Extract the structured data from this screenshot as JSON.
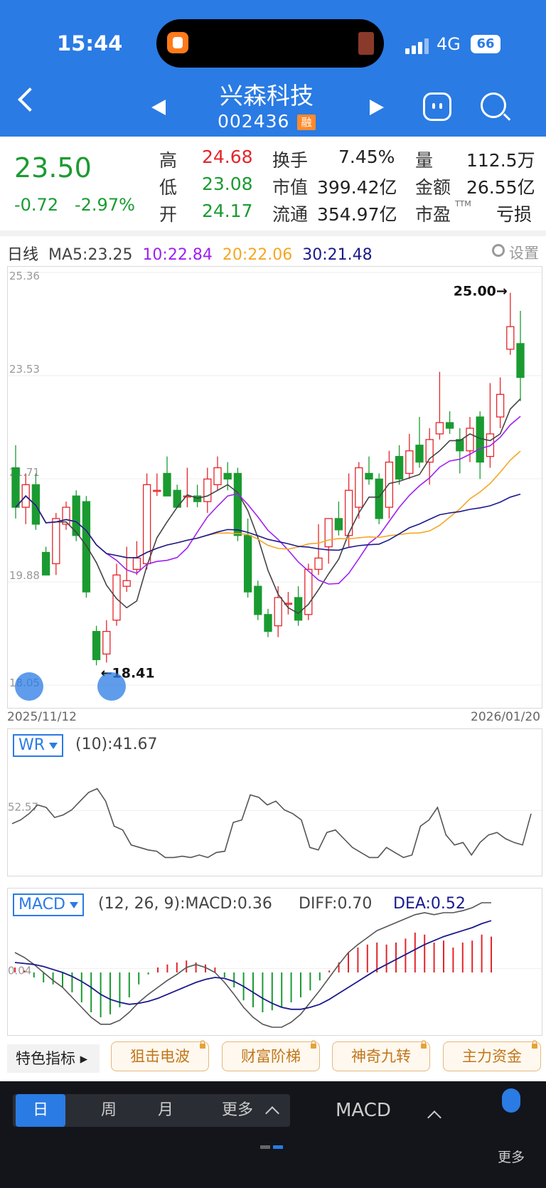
{
  "status_bar": {
    "time": "15:44",
    "network": "4G",
    "battery": "66"
  },
  "header": {
    "name": "兴森科技",
    "code": "002436",
    "margin_badge": "融"
  },
  "quote": {
    "price": "23.50",
    "change": "-0.72",
    "change_pct": "-2.97%",
    "high_label": "高",
    "high": "24.68",
    "low_label": "低",
    "low": "23.08",
    "open_label": "开",
    "open": "24.17",
    "turnover_label": "换手",
    "turnover": "7.45%",
    "mcap_label": "市值",
    "mcap": "399.42亿",
    "float_label": "流通",
    "float": "354.97亿",
    "vol_label": "量",
    "vol": "112.5万",
    "amount_label": "金额",
    "amount": "26.55亿",
    "pe_label": "市盈",
    "pe_sup": "TTM",
    "pe": "亏损"
  },
  "ma_legend": {
    "period": "日线",
    "ma5": "MA5:23.25",
    "ma10": "10:22.84",
    "ma20": "20:22.06",
    "ma30": "30:21.48",
    "settings": "设置"
  },
  "colors": {
    "up": "#e4252b",
    "down": "#1a9b31",
    "ma5": "#444444",
    "ma10": "#a020f0",
    "ma20": "#f5a623",
    "ma30": "#1a1a8c",
    "accent": "#2a7be4"
  },
  "main_chart": {
    "ylabels": [
      "25.36",
      "23.53",
      "21.71",
      "19.88",
      "18.05"
    ],
    "start_date": "2025/11/12",
    "end_date": "2026/01/20",
    "high_marker": "25.00→",
    "low_marker": "←18.41"
  },
  "wr": {
    "name": "WR",
    "value": "(10):41.67",
    "level": "52.57"
  },
  "macd": {
    "name": "MACD",
    "params": "(12, 26, 9):MACD:0.36",
    "diff": "DIFF:0.70",
    "dea": "DEA:0.52",
    "level": "0.04"
  },
  "features": {
    "title": "特色指标",
    "items": [
      "狙击电波",
      "财富阶梯",
      "神奇九转",
      "主力资金"
    ]
  },
  "bottom": {
    "tabs": [
      "日",
      "周",
      "月",
      "更多"
    ],
    "indicator": "MACD",
    "more": "更多"
  },
  "chart_data": [
    {
      "type": "candlestick",
      "title": "",
      "ylim": [
        18.05,
        25.36
      ],
      "x_range": [
        "2025/11/12",
        "2026/01/20"
      ],
      "candles_ohlc": [
        [
          21.9,
          22.3,
          21.0,
          21.2
        ],
        [
          21.2,
          21.8,
          20.9,
          21.6
        ],
        [
          21.6,
          21.8,
          20.8,
          20.9
        ],
        [
          20.4,
          20.5,
          20.0,
          20.0
        ],
        [
          20.2,
          21.1,
          20.0,
          21.0
        ],
        [
          20.9,
          21.3,
          20.8,
          21.2
        ],
        [
          21.4,
          21.5,
          20.6,
          20.7
        ],
        [
          21.3,
          21.4,
          19.6,
          19.7
        ],
        [
          19.0,
          19.1,
          18.4,
          18.5
        ],
        [
          18.6,
          19.2,
          18.45,
          19.0
        ],
        [
          19.2,
          20.2,
          19.1,
          20.0
        ],
        [
          19.8,
          20.5,
          19.7,
          19.9
        ],
        [
          20.1,
          20.6,
          20.0,
          20.3
        ],
        [
          20.2,
          21.8,
          20.1,
          21.6
        ],
        [
          21.5,
          21.8,
          21.4,
          21.5
        ],
        [
          21.8,
          22.1,
          21.4,
          21.4
        ],
        [
          21.5,
          21.6,
          21.2,
          21.2
        ],
        [
          21.4,
          21.9,
          21.2,
          21.4
        ],
        [
          21.4,
          21.6,
          21.2,
          21.3
        ],
        [
          21.3,
          21.9,
          21.1,
          21.7
        ],
        [
          21.6,
          22.1,
          21.5,
          21.9
        ],
        [
          21.8,
          22.0,
          21.5,
          21.7
        ],
        [
          21.8,
          21.9,
          20.6,
          20.7
        ],
        [
          20.7,
          21.0,
          19.6,
          19.7
        ],
        [
          19.8,
          19.9,
          19.2,
          19.3
        ],
        [
          19.3,
          19.4,
          18.9,
          19.0
        ],
        [
          19.1,
          19.8,
          18.9,
          19.6
        ],
        [
          19.5,
          19.7,
          19.3,
          19.5
        ],
        [
          19.6,
          19.8,
          19.1,
          19.2
        ],
        [
          19.3,
          20.2,
          19.2,
          20.1
        ],
        [
          20.1,
          20.9,
          20.0,
          20.3
        ],
        [
          20.5,
          21.0,
          20.2,
          21.0
        ],
        [
          21.0,
          21.3,
          20.7,
          20.8
        ],
        [
          20.7,
          21.8,
          20.5,
          21.5
        ],
        [
          21.2,
          22.0,
          21.0,
          21.9
        ],
        [
          21.8,
          22.1,
          21.6,
          21.7
        ],
        [
          21.7,
          21.8,
          20.9,
          21.0
        ],
        [
          21.2,
          22.2,
          21.0,
          22.0
        ],
        [
          22.1,
          22.3,
          21.6,
          21.7
        ],
        [
          21.8,
          22.5,
          21.7,
          22.2
        ],
        [
          22.3,
          22.8,
          21.9,
          22.0
        ],
        [
          22.0,
          22.6,
          21.6,
          22.4
        ],
        [
          22.5,
          23.6,
          22.4,
          22.7
        ],
        [
          22.7,
          22.9,
          22.5,
          22.6
        ],
        [
          22.4,
          22.6,
          21.8,
          22.2
        ],
        [
          22.2,
          22.8,
          22.0,
          22.6
        ],
        [
          22.8,
          22.9,
          21.7,
          22.0
        ],
        [
          22.1,
          23.4,
          21.9,
          22.5
        ],
        [
          22.8,
          23.5,
          22.6,
          23.2
        ],
        [
          24.0,
          25.0,
          23.9,
          24.4
        ],
        [
          24.1,
          24.68,
          23.08,
          23.5
        ]
      ],
      "ma5_last": 23.25,
      "ma10_last": 22.84,
      "ma20_last": 22.06,
      "ma30_last": 21.48,
      "high_annotation": 25.0,
      "low_annotation": 18.41
    },
    {
      "type": "line",
      "name": "WR",
      "level": 52.57,
      "values": [
        63,
        60,
        55,
        48,
        50,
        58,
        56,
        52,
        45,
        38,
        35,
        45,
        65,
        68,
        80,
        82,
        84,
        85,
        90,
        90,
        89,
        90,
        88,
        90,
        86,
        85,
        62,
        60,
        40,
        42,
        48,
        45,
        52,
        55,
        60,
        82,
        84,
        70,
        68,
        75,
        82,
        86,
        90,
        90,
        82,
        86,
        90,
        88,
        65,
        60,
        50,
        72,
        80,
        78,
        88,
        78,
        72,
        70,
        75,
        78,
        80,
        55
      ]
    },
    {
      "type": "bar+line",
      "name": "MACD",
      "level": 0.04,
      "histogram": [
        0.05,
        0.02,
        -0.05,
        -0.1,
        -0.12,
        -0.15,
        -0.2,
        -0.3,
        -0.4,
        -0.45,
        -0.42,
        -0.35,
        -0.25,
        -0.12,
        -0.02,
        0.05,
        0.08,
        0.1,
        0.12,
        0.1,
        0.08,
        0.05,
        -0.05,
        -0.15,
        -0.28,
        -0.35,
        -0.4,
        -0.38,
        -0.35,
        -0.3,
        -0.25,
        -0.18,
        -0.08,
        0.02,
        0.1,
        0.2,
        0.25,
        0.28,
        0.3,
        0.28,
        0.3,
        0.34,
        0.4,
        0.38,
        0.3,
        0.32,
        0.25,
        0.3,
        0.32,
        0.38,
        0.36
      ],
      "diff": [
        0.2,
        0.15,
        0.08,
        0.0,
        -0.08,
        -0.15,
        -0.25,
        -0.35,
        -0.45,
        -0.52,
        -0.52,
        -0.48,
        -0.4,
        -0.3,
        -0.22,
        -0.15,
        -0.08,
        -0.02,
        0.05,
        0.08,
        0.05,
        0.0,
        -0.1,
        -0.22,
        -0.35,
        -0.45,
        -0.52,
        -0.55,
        -0.55,
        -0.5,
        -0.42,
        -0.3,
        -0.18,
        -0.05,
        0.08,
        0.2,
        0.28,
        0.35,
        0.42,
        0.46,
        0.5,
        0.54,
        0.58,
        0.6,
        0.58,
        0.6,
        0.6,
        0.62,
        0.65,
        0.7,
        0.7
      ],
      "dea": [
        0.1,
        0.09,
        0.08,
        0.06,
        0.03,
        0.0,
        -0.04,
        -0.09,
        -0.15,
        -0.22,
        -0.27,
        -0.3,
        -0.32,
        -0.31,
        -0.29,
        -0.26,
        -0.22,
        -0.18,
        -0.14,
        -0.1,
        -0.07,
        -0.05,
        -0.06,
        -0.09,
        -0.14,
        -0.2,
        -0.26,
        -0.31,
        -0.35,
        -0.37,
        -0.37,
        -0.35,
        -0.32,
        -0.27,
        -0.21,
        -0.15,
        -0.09,
        -0.03,
        0.03,
        0.08,
        0.13,
        0.18,
        0.23,
        0.28,
        0.32,
        0.36,
        0.39,
        0.42,
        0.45,
        0.49,
        0.52
      ]
    }
  ]
}
